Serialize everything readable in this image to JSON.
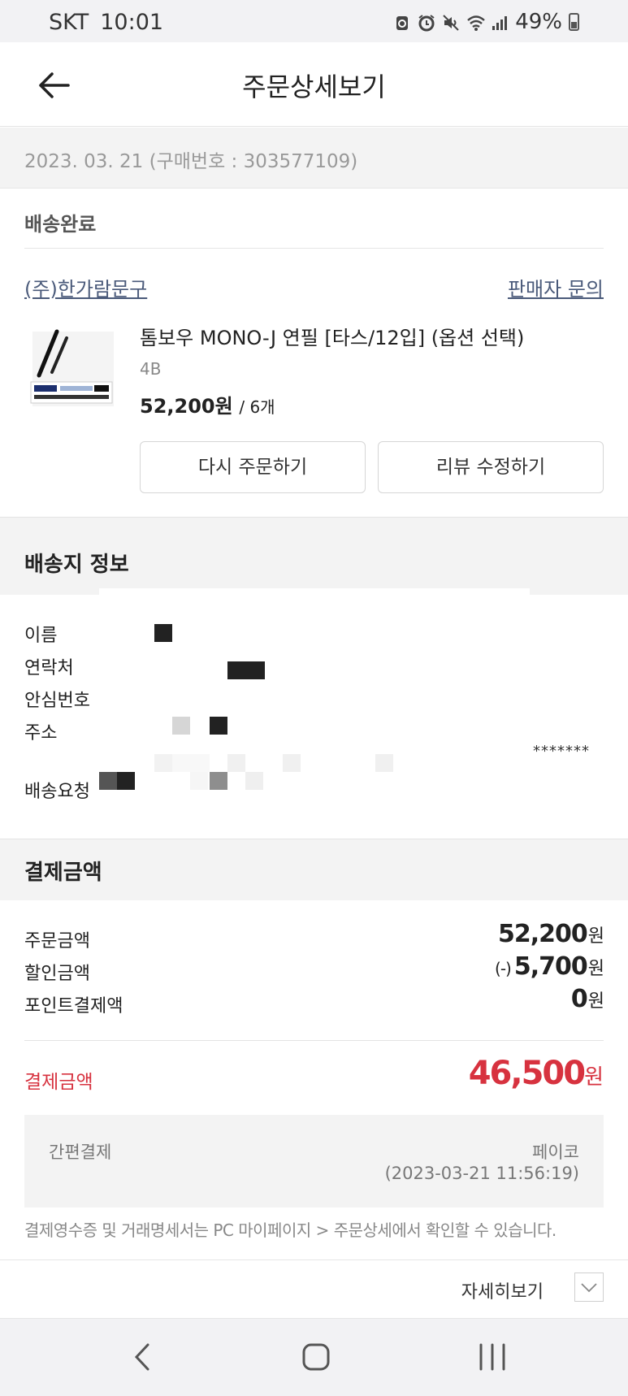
{
  "status_bar": {
    "carrier": "SKT",
    "time": "10:01",
    "battery": "49%",
    "icons": [
      "sync-icon",
      "alarm-icon",
      "mute-icon",
      "wifi-icon",
      "signal-icon",
      "battery-icon"
    ]
  },
  "header": {
    "title": "주문상세보기"
  },
  "order": {
    "date_line": "2023. 03. 21 (구매번호 : 303577109)",
    "status": "배송완료",
    "seller": "(주)한가람문구",
    "inquiry_link": "판매자 문의",
    "product": {
      "name": "톰보우 MONO-J 연필 [타스/12입] (옵션 선택)",
      "option": "4B",
      "price": "52,200원",
      "quantity": "/ 6개"
    },
    "reorder_button": "다시 주문하기",
    "review_button": "리뷰 수정하기"
  },
  "shipping": {
    "title": "배송지 정보",
    "labels": {
      "name": "이름",
      "contact": "연락처",
      "safe_number": "안심번호",
      "address": "주소",
      "request": "배송요청"
    },
    "masked_suffix": "*******"
  },
  "payment": {
    "title": "결제금액",
    "rows": [
      {
        "label": "주문금액",
        "prefix": "",
        "amount": "52,200",
        "unit": "원"
      },
      {
        "label": "할인금액",
        "prefix": "(-)",
        "amount": "5,700",
        "unit": "원"
      },
      {
        "label": "포인트결제액",
        "prefix": "",
        "amount": "0",
        "unit": "원"
      }
    ],
    "total_label": "결제금액",
    "total_amount": "46,500",
    "total_unit": "원",
    "method_label": "간편결제",
    "method_name": "페이코",
    "method_time": "(2023-03-21 11:56:19)",
    "receipt_note": "결제영수증 및 거래명세서는 PC 마이페이지 > 주문상세에서 확인할 수 있습니다.",
    "details_label": "자세히보기"
  },
  "colors": {
    "accent_red": "#d7323f",
    "link": "#4a5a7a",
    "section_bg": "#f3f3f3"
  }
}
